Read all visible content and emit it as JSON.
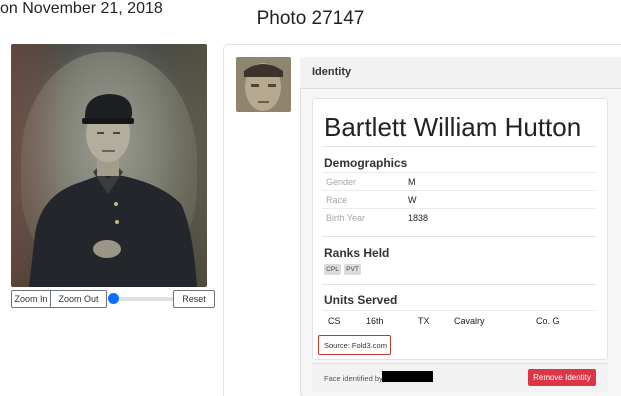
{
  "page": {
    "title": "Photo 27147"
  },
  "photo_controls": {
    "zoom_in": "Zoom In",
    "zoom_out": "Zoom Out",
    "reset": "Reset",
    "zoom_level": 0
  },
  "identity": {
    "header": "Identity",
    "name": "Bartlett William Hutton",
    "demographics": {
      "title": "Demographics",
      "rows": [
        {
          "label": "Gender",
          "value": "M"
        },
        {
          "label": "Race",
          "value": "W"
        },
        {
          "label": "Birth Year",
          "value": "1838"
        }
      ]
    },
    "ranks": {
      "title": "Ranks Held",
      "badges": [
        "CPL",
        "PVT"
      ]
    },
    "units": {
      "title": "Units Served",
      "row": [
        "CS",
        "16th",
        "TX",
        "Cavalry",
        "Co. G"
      ]
    },
    "source": "Source: Fold3.com",
    "footer": {
      "identified_prefix": "Face identified by",
      "date_text": "on November 21, 2018",
      "remove_button": "Remove Identity"
    }
  },
  "colors": {
    "danger": "#dc3545",
    "accent": "#0d6efd",
    "source_outline": "#c0392b"
  }
}
